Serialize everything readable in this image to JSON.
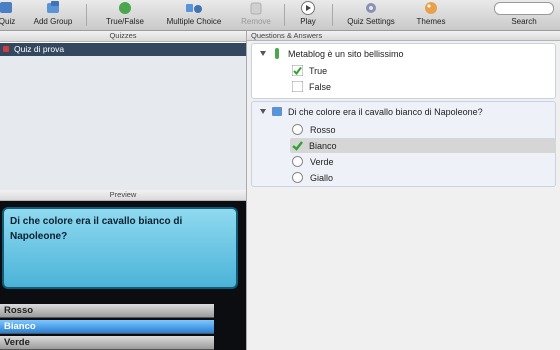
{
  "toolbar": {
    "quiz": "Quiz",
    "add_group": "Add Group",
    "true_false": "True/False",
    "multiple_choice": "Multiple Choice",
    "remove": "Remove",
    "play": "Play",
    "quiz_settings": "Quiz Settings",
    "themes": "Themes",
    "search": "Search"
  },
  "quizzes": {
    "header": "Quizzes",
    "items": [
      "Quiz di prova"
    ]
  },
  "preview": {
    "header": "Preview",
    "question": "Di che colore era il cavallo bianco di Napoleone?",
    "answers": [
      "Rosso",
      "Bianco",
      "Verde"
    ],
    "selected_index": 1
  },
  "qa": {
    "header": "Questions & Answers",
    "questions": [
      {
        "text": "Metablog è un sito bellissimo",
        "answers": [
          "True",
          "False"
        ],
        "correct_index": 0
      },
      {
        "text": "Di che colore era il cavallo bianco di Napoleone?",
        "answers": [
          "Rosso",
          "Bianco",
          "Verde",
          "Giallo"
        ],
        "correct_index": 1
      }
    ]
  },
  "colors": {
    "selected_row": "#33485f",
    "preview_blue": "#4bb3d8",
    "check_green": "#2fa32f"
  }
}
